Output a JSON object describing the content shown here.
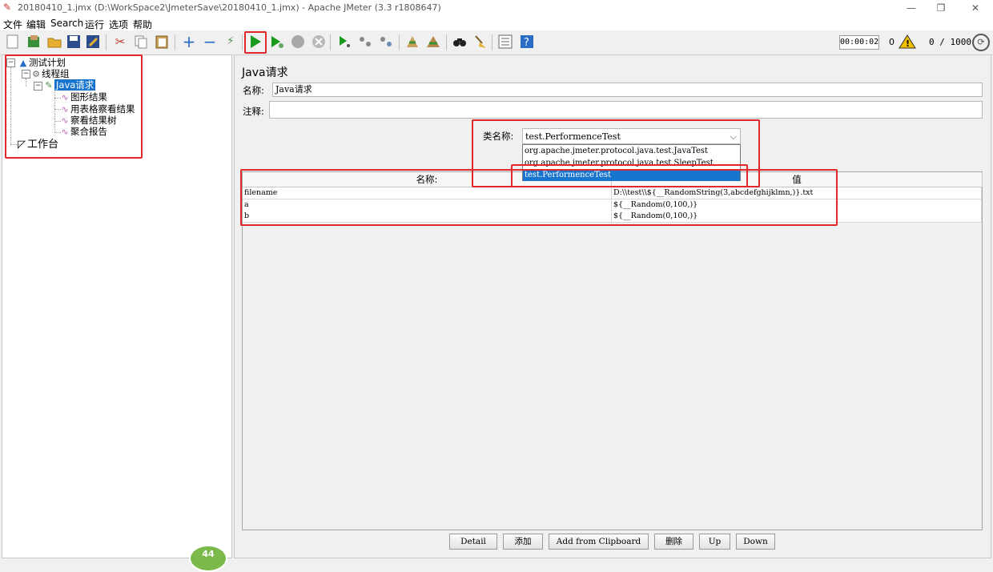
{
  "window": {
    "title": "20180410_1.jmx (D:\\WorkSpace2\\JmeterSave\\20180410_1.jmx) - Apache JMeter (3.3 r1808647)",
    "minimize": "—",
    "maximize": "❐",
    "close": "✕"
  },
  "menu": [
    "文件",
    "编辑",
    "Search",
    "运行",
    "选项",
    "帮助"
  ],
  "toolbar": {
    "timer": "00:00:02",
    "warning_count": "0",
    "threads": "0 / 1000"
  },
  "tree": {
    "test_plan": "测试计划",
    "thread_group": "线程组",
    "java_request": "Java请求",
    "listeners": [
      "图形结果",
      "用表格察看结果",
      "察看结果树",
      "聚合报告"
    ],
    "workbench": "工作台"
  },
  "panel": {
    "title": "Java请求",
    "name_label": "名称:",
    "name_value": "Java请求",
    "comment_label": "注释:",
    "comment_value": "",
    "classname_label": "类名称:",
    "classname_value": "test.PerformenceTest",
    "classname_options": [
      "org.apache.jmeter.protocol.java.test.JavaTest",
      "org.apache.jmeter.protocol.java.test.SleepTest",
      "test.PerformenceTest"
    ]
  },
  "params": {
    "headers": [
      "名称:",
      "值"
    ],
    "rows": [
      [
        "filename",
        "D:\\\\test\\\\${__RandomString(3,abcdefghijklmn,)}.txt"
      ],
      [
        "a",
        "${__Random(0,100,)}"
      ],
      [
        "b",
        "${__Random(0,100,)}"
      ]
    ]
  },
  "buttons": {
    "detail": "Detail",
    "add": "添加",
    "add_clipboard": "Add from Clipboard",
    "delete": "删除",
    "up": "Up",
    "down": "Down"
  },
  "badge": "44",
  "icons": {
    "new": "new-file-icon",
    "templates": "templates-icon",
    "open": "open-folder-icon",
    "save": "save-icon",
    "save_as": "save-as-icon",
    "cut": "cut-icon",
    "copy": "copy-icon",
    "paste": "paste-icon",
    "expand": "expand-icon",
    "collapse": "collapse-icon",
    "toggle": "toggle-icon",
    "start": "start-icon",
    "start_no_pause": "start-no-timers-icon",
    "stop": "stop-icon",
    "shutdown": "shutdown-icon",
    "remote_start": "remote-start-icon",
    "remote_stop": "remote-stop-icon",
    "remote_shutdown": "remote-shutdown-icon",
    "clear": "clear-icon",
    "clear_all": "clear-all-icon",
    "search": "search-binoculars-icon",
    "reset_search": "reset-search-broom-icon",
    "function_helper": "function-helper-icon",
    "help": "help-icon"
  },
  "colors": {
    "selection": "#1874cd",
    "annotation": "#e0282a",
    "run_green": "#1a9a1a"
  }
}
